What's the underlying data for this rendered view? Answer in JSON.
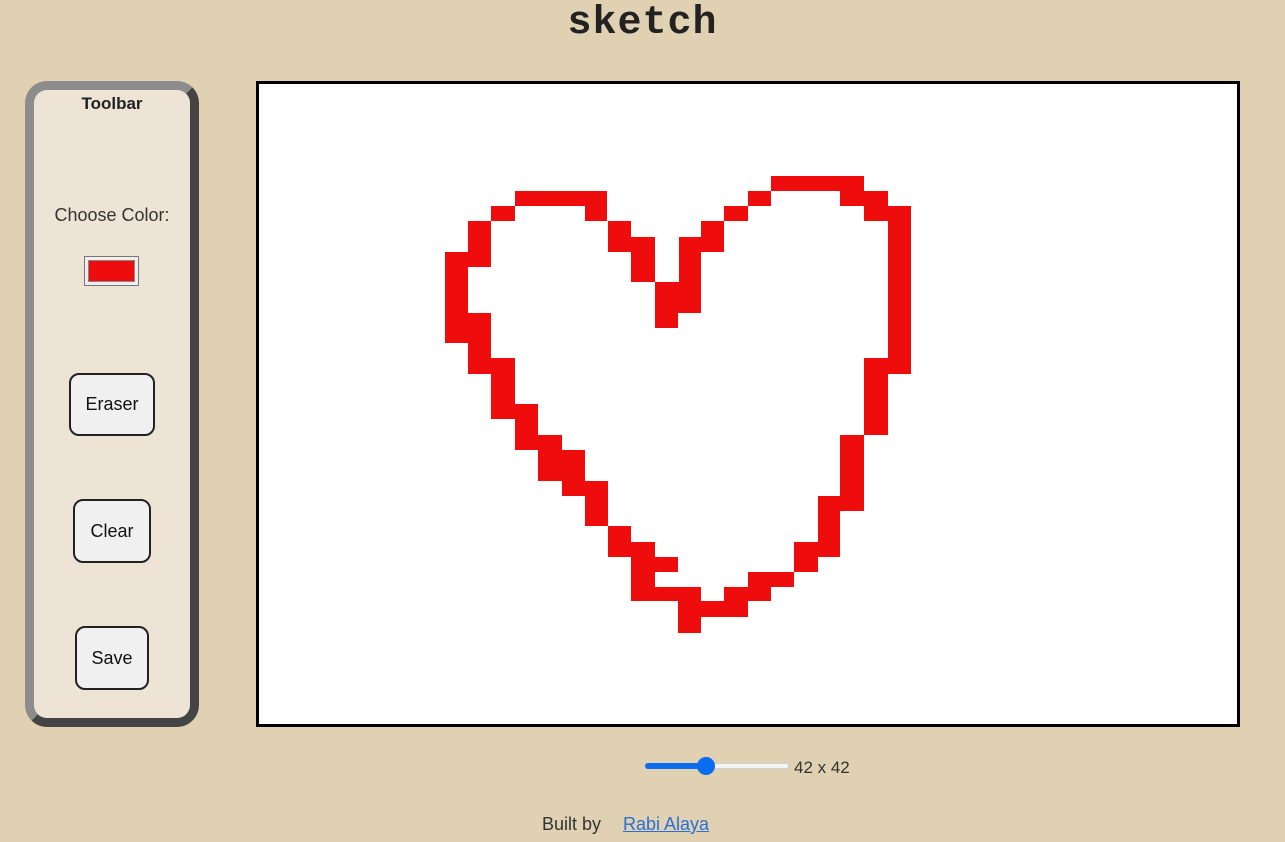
{
  "app": {
    "title": "sketch"
  },
  "toolbar": {
    "title": "Toolbar",
    "color_label": "Choose Color:",
    "selected_color": "#ee0c0c",
    "eraser_label": "Eraser",
    "clear_label": "Clear",
    "save_label": "Save"
  },
  "grid": {
    "size_label": "42 x 42",
    "slider_value": 42,
    "slider_min": 1,
    "slider_max": 100
  },
  "footer": {
    "built_by": "Built by",
    "author_link": "Rabi Alaya"
  },
  "icons": {
    "color_swatch": "color-swatch",
    "slider_thumb": "slider-thumb"
  },
  "colors": {
    "background": "#e0d1b3",
    "toolbar_bg": "#ede4d5",
    "canvas_bg": "#ffffff",
    "pen": "#ee0c0c",
    "accent": "#0a6cf0",
    "link": "#2a6fd6"
  }
}
